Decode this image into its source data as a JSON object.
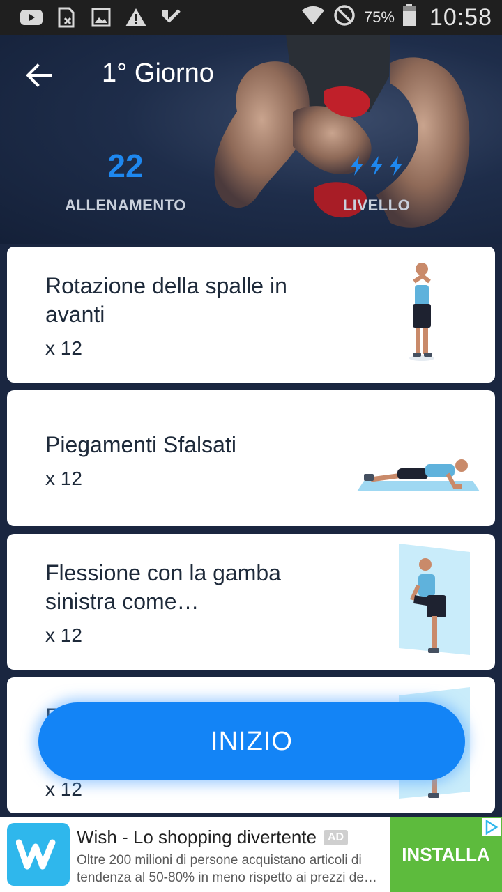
{
  "status_bar": {
    "icons": [
      "youtube-icon",
      "sim-icon",
      "image-icon",
      "warning-icon",
      "check-icon"
    ],
    "right_icons": [
      "wifi-icon",
      "do-not-disturb-icon"
    ],
    "battery": "75%",
    "time": "10:58"
  },
  "header": {
    "title": "1° Giorno",
    "back_icon": "arrow-left-icon"
  },
  "stats": {
    "workouts_value": "22",
    "workouts_label": "ALLENAMENTO",
    "level_icon": "lightning-bolt-icon",
    "level_count": 3,
    "level_label": "LIVELLO"
  },
  "exercises": [
    {
      "title": "Rotazione della spalle in avanti",
      "reps": "x 12"
    },
    {
      "title": "Piegamenti Sfalsati",
      "reps": "x 12"
    },
    {
      "title": "Flessione con la gamba sinistra come…",
      "reps": "x 12"
    },
    {
      "title": "F",
      "reps": "x 12"
    }
  ],
  "start_button": {
    "label": "INIZIO"
  },
  "ad": {
    "title": "Wish - Lo shopping divertente",
    "badge": "AD",
    "description": "Oltre 200 milioni di persone acquistano articoli di tendenza al 50-80% in meno rispetto ai prezzi de…",
    "cta": "INSTALLA",
    "colors": {
      "logo": "#2fb7ec",
      "cta": "#5dbb3d"
    }
  },
  "colors": {
    "accent": "#1e88f0",
    "button": "#1384f6",
    "hero": "#1e2d4a"
  }
}
